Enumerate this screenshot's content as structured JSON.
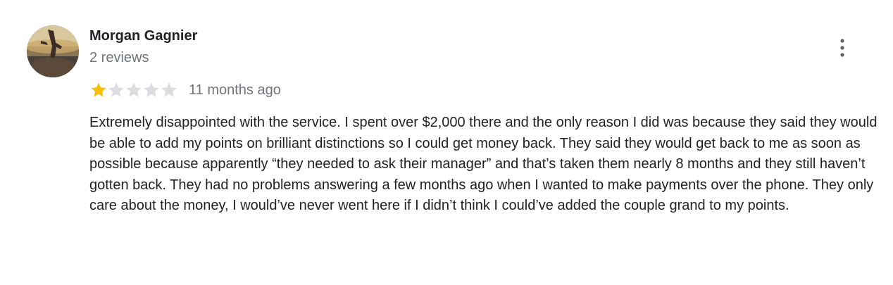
{
  "review": {
    "author_name": "Morgan Gagnier",
    "author_reviews": "2 reviews",
    "rating": 1,
    "max_rating": 5,
    "date": "11 months ago",
    "text": "Extremely disappointed with the service. I spent over $2,000 there and the only reason I did was because they said they would be able to add my points on brilliant distinctions so I could get money back. They said they would get back to me as soon as possible because apparently “they needed to ask their manager” and that’s taken them nearly 8 months and they still haven’t gotten back. They had no problems answering a few months ago when I wanted to make payments over the phone. They only care about the money, I would’ve never went here if I didn’t think I could’ve added the couple grand to my points."
  },
  "icons": {
    "menu": "more-vert-icon",
    "star": "star-icon"
  },
  "colors": {
    "star_filled": "#fbbc04",
    "star_empty": "#dadce0",
    "secondary_text": "#70757a",
    "menu_icon": "#5f6368"
  }
}
